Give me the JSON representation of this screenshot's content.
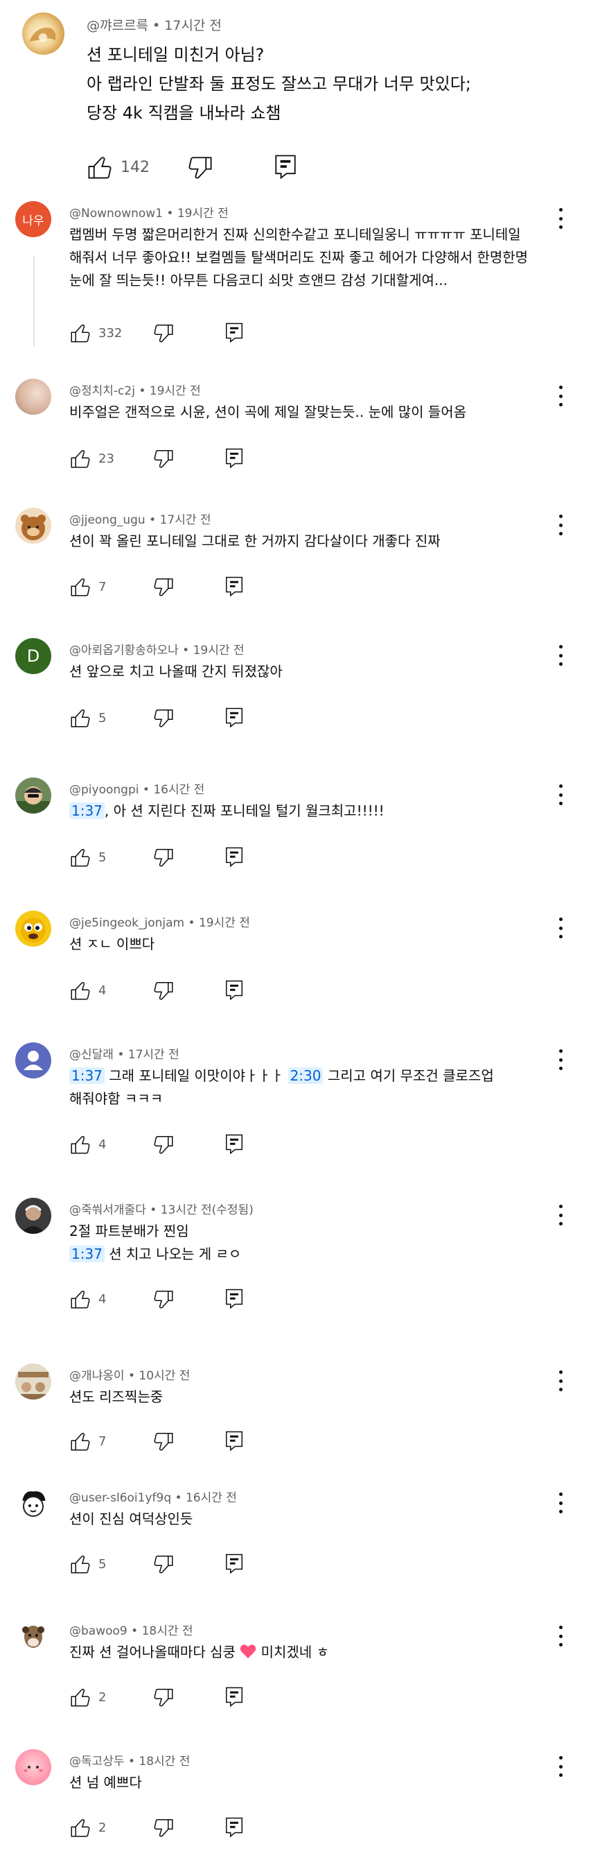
{
  "top_comment": {
    "author": "@꺄르르륵",
    "time": "17시간 전",
    "lines": [
      "션 포니테일 미친거 아님?",
      "아 랩라인 단발좌 둘 표정도 잘쓰고 무대가 너무 맛있다;",
      "당장 4k 직캠을 내놔라 쇼챔"
    ],
    "likes": "142"
  },
  "replies": [
    {
      "author": "@Nownownow1",
      "time": "19시간 전",
      "avatar_text": "나우",
      "avatar_color": "#e8532f",
      "lines": [
        "랩멤버 두명 짧은머리한거 진짜 신의한수같고 포니테일웅니 ㅠㅠㅠㅠ 포니테일",
        "해줘서 너무 좋아요!! 보컬멤들 탈색머리도 진짜 좋고 헤어가 다양해서 한명한명",
        "눈에 잘 띄는듯!! 아무튼 다음코디 쇠맛 흐앤므 감성 기대할게여..."
      ],
      "likes": "332"
    },
    {
      "author": "@정치치-c2j",
      "time": "19시간 전",
      "lines": [
        "비주얼은 갠적으로 시윤, 션이 곡에 제일 잘맞는듯.. 눈에 많이 들어옴"
      ],
      "likes": "23"
    },
    {
      "author": "@jjeong_ugu",
      "time": "17시간 전",
      "lines": [
        "션이 꽉 올린 포니테일 그대로 한 거까지 감다살이다 개좋다 진짜"
      ],
      "likes": "7"
    },
    {
      "author": "@아뢰옵기황송하오나",
      "time": "19시간 전",
      "avatar_text": "D",
      "avatar_color": "#33691e",
      "lines": [
        "션 앞으로 치고 나올때 간지 뒤졌잖아"
      ],
      "likes": "5"
    },
    {
      "author": "@piyoongpi",
      "time": "16시간 전",
      "ts": "1:37",
      "rest": ", 아 션 지린다 진짜 포니테일 털기 월크최고!!!!!",
      "likes": "5"
    },
    {
      "author": "@je5ingeok_jonjam",
      "time": "19시간 전",
      "lines": [
        "션 ㅈㄴ 이쁘다"
      ],
      "likes": "4"
    },
    {
      "author": "@신달래",
      "time": "17시간 전",
      "ts1": "1:37",
      "mid": " 그래 포니테일 이맛이야ㅏㅏㅏ ",
      "ts2": "2:30",
      "rest": " 그리고 여기 무조건 클로즈업",
      "line2": "해줘야함 ㅋㅋㅋ",
      "likes": "4"
    },
    {
      "author": "@죽쒀서개줄다",
      "time": "13시간 전(수정됨)",
      "line1": "2절 파트분배가 찐임",
      "ts": "1:37",
      "rest": " 션 치고 나오는 게 ㄹㅇ",
      "likes": "4"
    },
    {
      "author": "@개냐옹이",
      "time": "10시간 전",
      "lines": [
        "션도 리즈찍는중"
      ],
      "likes": "7"
    },
    {
      "author": "@user-sl6oi1yf9q",
      "time": "16시간 전",
      "lines": [
        "션이 진심 여덕상인듯"
      ],
      "likes": "5"
    },
    {
      "author": "@bawoo9",
      "time": "18시간 전",
      "pre": "진짜 션 걸어나올때마다 심쿵 ",
      "post": " 미치겠네 ㅎ",
      "likes": "2"
    },
    {
      "author": "@독고상두",
      "time": "18시간 전",
      "lines": [
        "션 넘 예쁘다"
      ],
      "likes": "2"
    }
  ],
  "colors": {
    "text": "#0f0f0f",
    "meta": "#606060",
    "timestamp_bg": "#def1ff",
    "timestamp_fg": "#065fd4",
    "heart": "#ff4f7b"
  },
  "icons": [
    "thumb-up-icon",
    "thumb-down-icon",
    "reply-icon",
    "more-vert-icon",
    "heart-emoji-icon"
  ]
}
